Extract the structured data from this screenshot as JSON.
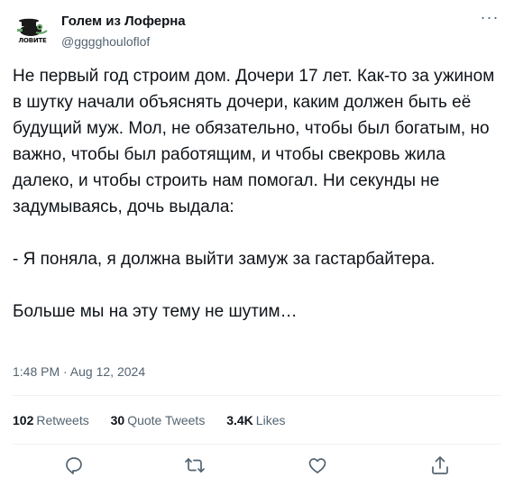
{
  "author": {
    "name": "Голем из Лоферна",
    "handle": "@gggghouloflof",
    "avatar_text": "ЛОВИТЕ"
  },
  "tweet": {
    "paragraphs": [
      "Не первый год строим дом. Дочери 17 лет. Как-то за ужином в шутку начали объяснять дочери, каким должен быть её будущий муж. Мол, не обязательно, чтобы был богатым, но важно, чтобы был работящим, и чтобы свекровь жила далеко, и чтобы строить нам помогал. Ни секунды не задумываясь, дочь выдала:",
      "- Я поняла, я должна выйти замуж за гастарбайтера.",
      "Больше мы на эту тему не шутим…"
    ],
    "timestamp": "1:48 PM · Aug 12, 2024"
  },
  "stats": {
    "retweets_count": "102",
    "retweets_label": "Retweets",
    "quotes_count": "30",
    "quotes_label": "Quote Tweets",
    "likes_count": "3.4K",
    "likes_label": "Likes"
  },
  "actions": {
    "more_icon": "more-horizontal-icon",
    "reply_icon": "reply-icon",
    "retweet_icon": "retweet-icon",
    "like_icon": "heart-icon",
    "share_icon": "share-icon"
  },
  "colors": {
    "text_primary": "#0f1419",
    "text_secondary": "#536471",
    "divider": "#eff3f4"
  }
}
